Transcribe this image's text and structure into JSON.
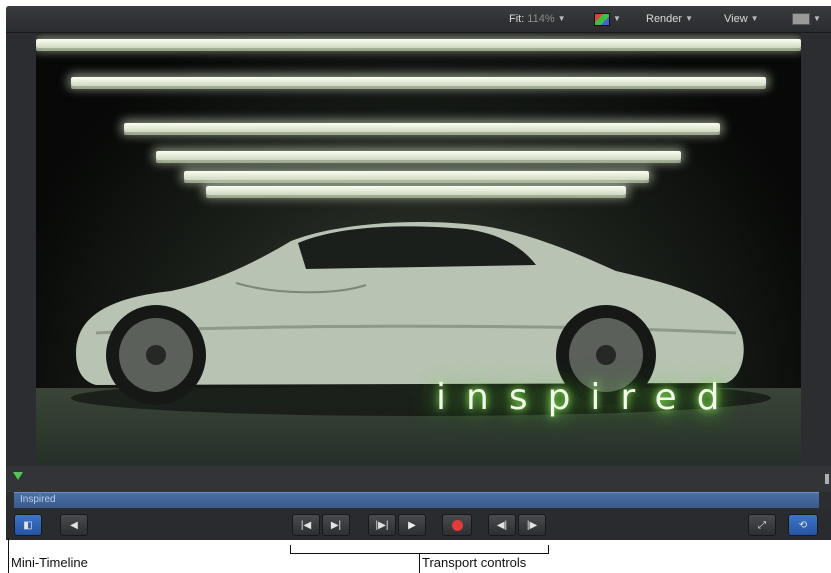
{
  "toolbar": {
    "fit_label": "Fit:",
    "fit_value": "114%",
    "render_label": "Render",
    "view_label": "View",
    "dropdown_glyph": "▼"
  },
  "canvas": {
    "overlay_text": "inspired"
  },
  "mini_timeline": {
    "clip_name": "Inspired"
  },
  "transport": {
    "icons": [
      "go-to-start-icon",
      "play-from-start-icon",
      "previous-frame-icon",
      "play-icon",
      "record-icon",
      "previous-keyframe-icon",
      "next-keyframe-icon"
    ],
    "glyphs": {
      "layers": "◧",
      "audio": "◀",
      "go_start": "|◀",
      "step_back": "▶|",
      "prev_frame": "|▶|",
      "play": "▶",
      "prev_key": "◀|",
      "next_key": "|▶",
      "fullscreen": "⤢",
      "loop": "⟲"
    }
  },
  "callouts": {
    "mini_timeline": "Mini-Timeline",
    "transport_controls": "Transport controls"
  },
  "colors": {
    "app_bg": "#2c2d30",
    "clip_bar": "#3f6096",
    "accent_blue": "#2f64b8",
    "playhead": "#57c35a",
    "record": "#e23b3b",
    "glow": "#7be84a"
  }
}
